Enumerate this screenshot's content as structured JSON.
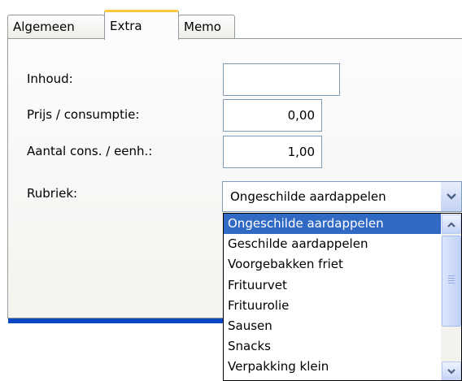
{
  "tabs": [
    {
      "label": "Algemeen",
      "active": false
    },
    {
      "label": "Extra",
      "active": true
    },
    {
      "label": "Memo",
      "active": false
    }
  ],
  "form": {
    "inhoud": {
      "label": "Inhoud:",
      "value": ""
    },
    "prijs": {
      "label": "Prijs / consumptie:",
      "value": "0,00"
    },
    "aantal": {
      "label": "Aantal cons. / eenh.:",
      "value": "1,00"
    },
    "rubriek": {
      "label": "Rubriek:",
      "value": "Ongeschilde aardappelen"
    }
  },
  "dropdown": {
    "selected": "Ongeschilde aardappelen",
    "items": [
      "Ongeschilde aardappelen",
      "Geschilde aardappelen",
      "Voorgebakken friet",
      "Frituurvet",
      "Frituurolie",
      "Sausen",
      "Snacks",
      "Verpakking klein"
    ]
  },
  "icons": {
    "combo_button": "chevron-down-icon",
    "scroll_up": "chevron-up-icon",
    "scroll_down": "chevron-down-icon"
  },
  "colors": {
    "selection": "#316ac5",
    "active_tab_accent": "#ffc83c",
    "bottom_bar": "#0a48c4"
  }
}
